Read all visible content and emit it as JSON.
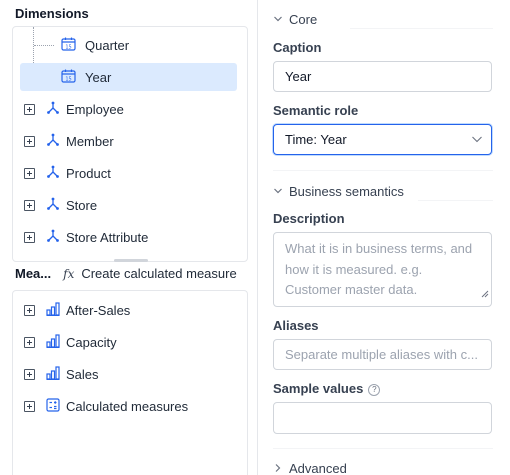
{
  "left": {
    "dimensions_title": "Dimensions",
    "dimension_items": [
      {
        "label": "Quarter"
      },
      {
        "label": "Year"
      },
      {
        "label": "Employee"
      },
      {
        "label": "Member"
      },
      {
        "label": "Product"
      },
      {
        "label": "Store"
      },
      {
        "label": "Store Attribute"
      }
    ],
    "measures_title": "Mea...",
    "create_calc_fx": "fx",
    "create_calc_label": "Create calculated measure",
    "measure_items": [
      {
        "label": "After-Sales"
      },
      {
        "label": "Capacity"
      },
      {
        "label": "Sales"
      },
      {
        "label": "Calculated measures"
      }
    ]
  },
  "right": {
    "core_group": "Core",
    "caption_label": "Caption",
    "caption_value": "Year",
    "semantic_role_label": "Semantic role",
    "semantic_role_value": "Time: Year",
    "business_group": "Business semantics",
    "description_label": "Description",
    "description_placeholder": "What it is in business terms, and how it is measured. e.g. Customer master data.",
    "aliases_label": "Aliases",
    "aliases_placeholder": "Separate multiple aliases with c...",
    "sample_values_label": "Sample values",
    "sample_values_help": "?",
    "advanced_group": "Advanced"
  },
  "colors": {
    "accent": "#2563eb",
    "selection": "#dbeafe",
    "icon_blue": "#2563eb"
  }
}
